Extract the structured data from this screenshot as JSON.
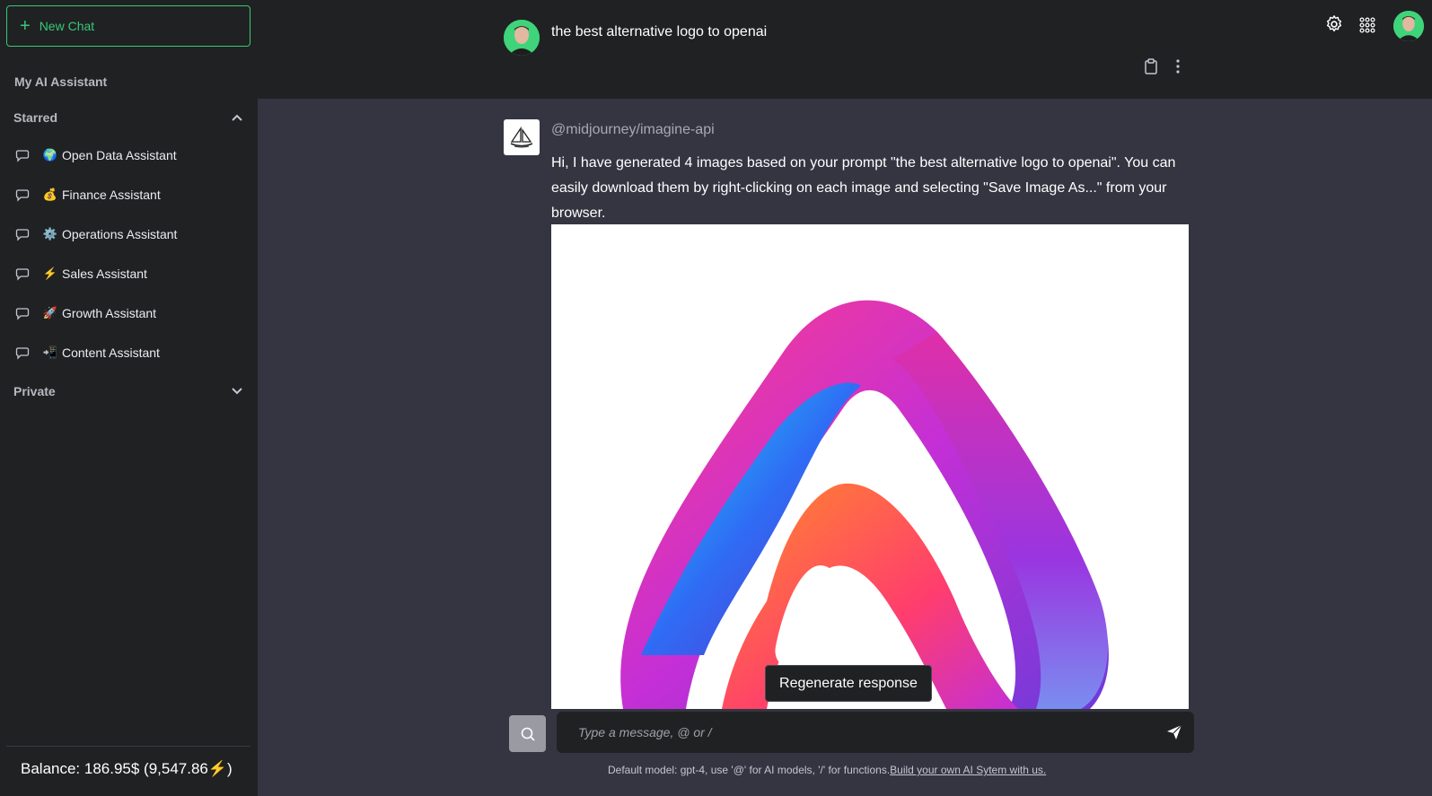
{
  "sidebar": {
    "new_chat_label": "New Chat",
    "assistant_heading": "My AI Assistant",
    "starred_label": "Starred",
    "private_label": "Private",
    "items": [
      {
        "emoji": "🌍",
        "label": "Open Data Assistant"
      },
      {
        "emoji": "💰",
        "label": "Finance Assistant"
      },
      {
        "emoji": "⚙️",
        "label": "Operations Assistant"
      },
      {
        "emoji": "⚡",
        "label": "Sales Assistant"
      },
      {
        "emoji": "🚀",
        "label": "Growth Assistant"
      },
      {
        "emoji": "📲",
        "label": "Content Assistant"
      }
    ],
    "balance": "Balance: 186.95$ (9,547.86⚡)"
  },
  "header": {
    "chat_title": "the best alternative logo to openai"
  },
  "message": {
    "sender": "@midjourney/imagine-api",
    "text": "Hi, I have generated 4 images based on your prompt \"the best alternative logo to openai\". You can easily download them by right-clicking on each image and selecting \"Save Image As...\" from your browser."
  },
  "regenerate_label": "Regenerate response",
  "input": {
    "placeholder": "Type a message, @ or /"
  },
  "footer": {
    "note": "Default model: gpt-4, use '@' for AI models, '/' for functions.",
    "link": "Build your own AI Sytem with us."
  },
  "colors": {
    "accent": "#37c978",
    "sidebar_bg": "#202123",
    "main_bg": "#343541"
  }
}
